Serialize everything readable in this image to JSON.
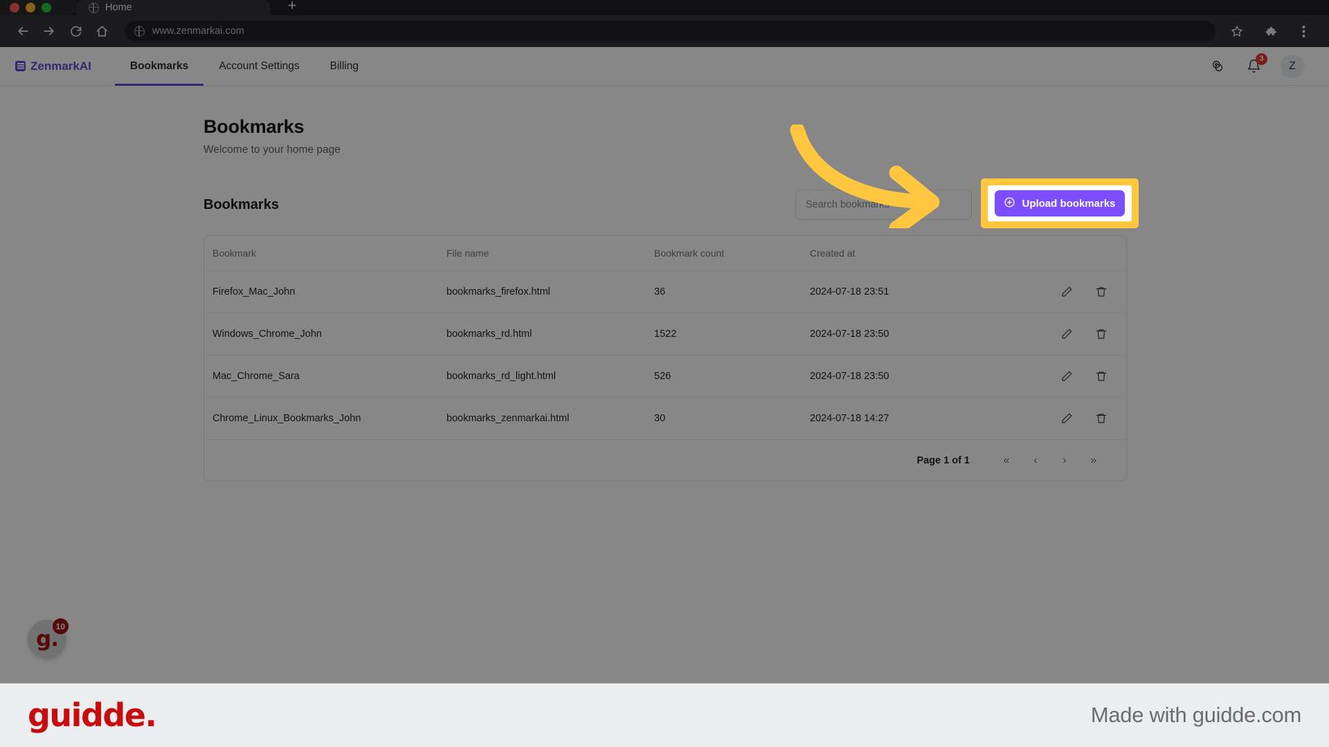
{
  "browser": {
    "tab": {
      "title": "Home",
      "favicon": "globe-icon"
    },
    "new_tab_label": "+",
    "url": "www.zenmarkai.com",
    "toolbar_icons": [
      "back-icon",
      "forward-icon",
      "reload-icon",
      "home-icon"
    ],
    "right_icons": [
      "star-icon",
      "extensions-puzzle-icon",
      "chrome-menu-icon"
    ]
  },
  "appnav": {
    "brand": "ZenmarkAI",
    "brand_color": "#6b46d6",
    "links": [
      {
        "label": "Bookmarks",
        "active": true
      },
      {
        "label": "Account Settings",
        "active": false
      },
      {
        "label": "Billing",
        "active": false
      }
    ],
    "credits_icon": "coins-icon",
    "notifications": {
      "icon": "bell-icon",
      "count": "3",
      "badge_color": "#e53935"
    },
    "avatar_initial": "Z"
  },
  "header": {
    "title": "Bookmarks",
    "subtitle": "Welcome to your home page"
  },
  "section": {
    "title": "Bookmarks",
    "search": {
      "placeholder": "Search bookmarks",
      "value": ""
    },
    "upload_button": {
      "label": "Upload bookmarks",
      "icon": "plus-circle-icon",
      "color": "#7c4dff"
    }
  },
  "table": {
    "columns": [
      "Bookmark",
      "File name",
      "Bookmark count",
      "Created at"
    ],
    "rows": [
      {
        "bookmark": "Firefox_Mac_John",
        "file_name": "bookmarks_firefox.html",
        "bookmark_count": "36",
        "created_at": "2024-07-18 23:51"
      },
      {
        "bookmark": "Windows_Chrome_John",
        "file_name": "bookmarks_rd.html",
        "bookmark_count": "1522",
        "created_at": "2024-07-18 23:50"
      },
      {
        "bookmark": "Mac_Chrome_Sara",
        "file_name": "bookmarks_rd_light.html",
        "bookmark_count": "526",
        "created_at": "2024-07-18 23:50"
      },
      {
        "bookmark": "Chrome_Linux_Bookmarks_John",
        "file_name": "bookmarks_zenmarkai.html",
        "bookmark_count": "30",
        "created_at": "2024-07-18 14:27"
      }
    ],
    "row_actions": [
      "edit-pencil-icon",
      "delete-trash-icon"
    ]
  },
  "pagination": {
    "label": "Page 1 of 1",
    "first": "«",
    "prev": "‹",
    "next": "›",
    "last": "»"
  },
  "guidde_badge": {
    "logo": "g.",
    "count": "10",
    "badge_color": "#a31212"
  },
  "footer": {
    "logo": "guidde.",
    "logo_color": "#c60c0c",
    "made_with": "Made with guidde.com"
  },
  "highlight": {
    "color": "#ffc73f",
    "target": "Upload bookmarks"
  }
}
